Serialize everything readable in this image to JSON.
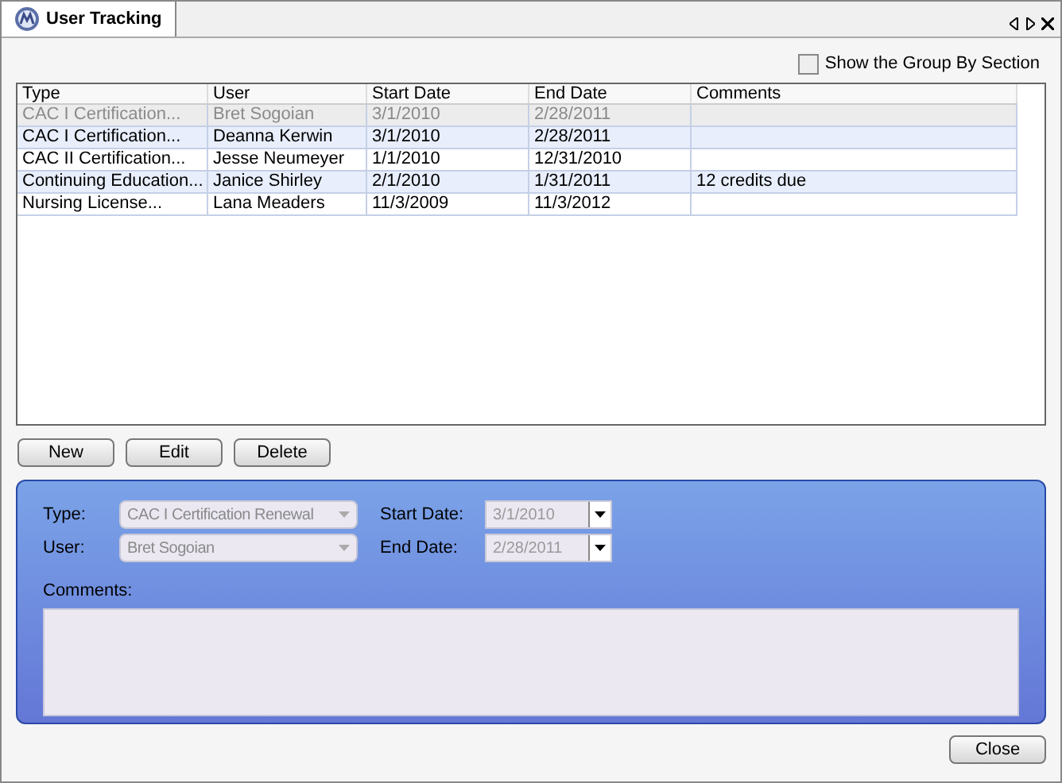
{
  "tab": {
    "title": "User Tracking"
  },
  "group_by": {
    "label": "Show the Group By Section",
    "checked": false
  },
  "table": {
    "columns": [
      "Type",
      "User",
      "Start Date",
      "End Date",
      "Comments"
    ],
    "rows": [
      {
        "selected": true,
        "cells": [
          "CAC I Certification...",
          "Bret Sogoian",
          "3/1/2010",
          "2/28/2011",
          ""
        ]
      },
      {
        "selected": false,
        "cells": [
          "CAC I Certification...",
          "Deanna Kerwin",
          "3/1/2010",
          "2/28/2011",
          ""
        ]
      },
      {
        "selected": false,
        "cells": [
          "CAC II Certification...",
          "Jesse Neumeyer",
          "1/1/2010",
          "12/31/2010",
          ""
        ]
      },
      {
        "selected": false,
        "cells": [
          "Continuing  Education...",
          "Janice Shirley",
          "2/1/2010",
          "1/31/2011",
          "12 credits due"
        ]
      },
      {
        "selected": false,
        "cells": [
          "Nursing License...",
          "Lana Meaders",
          "11/3/2009",
          "11/3/2012",
          ""
        ]
      }
    ]
  },
  "buttons": [
    "New",
    "Edit",
    "Delete"
  ],
  "form": {
    "type": {
      "label": "Type:",
      "value": "CAC I Certification Renewal",
      "disabled": true
    },
    "user": {
      "label": "User:",
      "value": "Bret Sogoian",
      "disabled": true
    },
    "start": {
      "label": "Start Date:",
      "value": "3/1/2010",
      "disabled": true
    },
    "end": {
      "label": "End Date:",
      "value": "2/28/2011",
      "disabled": true
    },
    "comments": {
      "label": "Comments:",
      "disabled": true
    }
  },
  "close_button": "Close"
}
